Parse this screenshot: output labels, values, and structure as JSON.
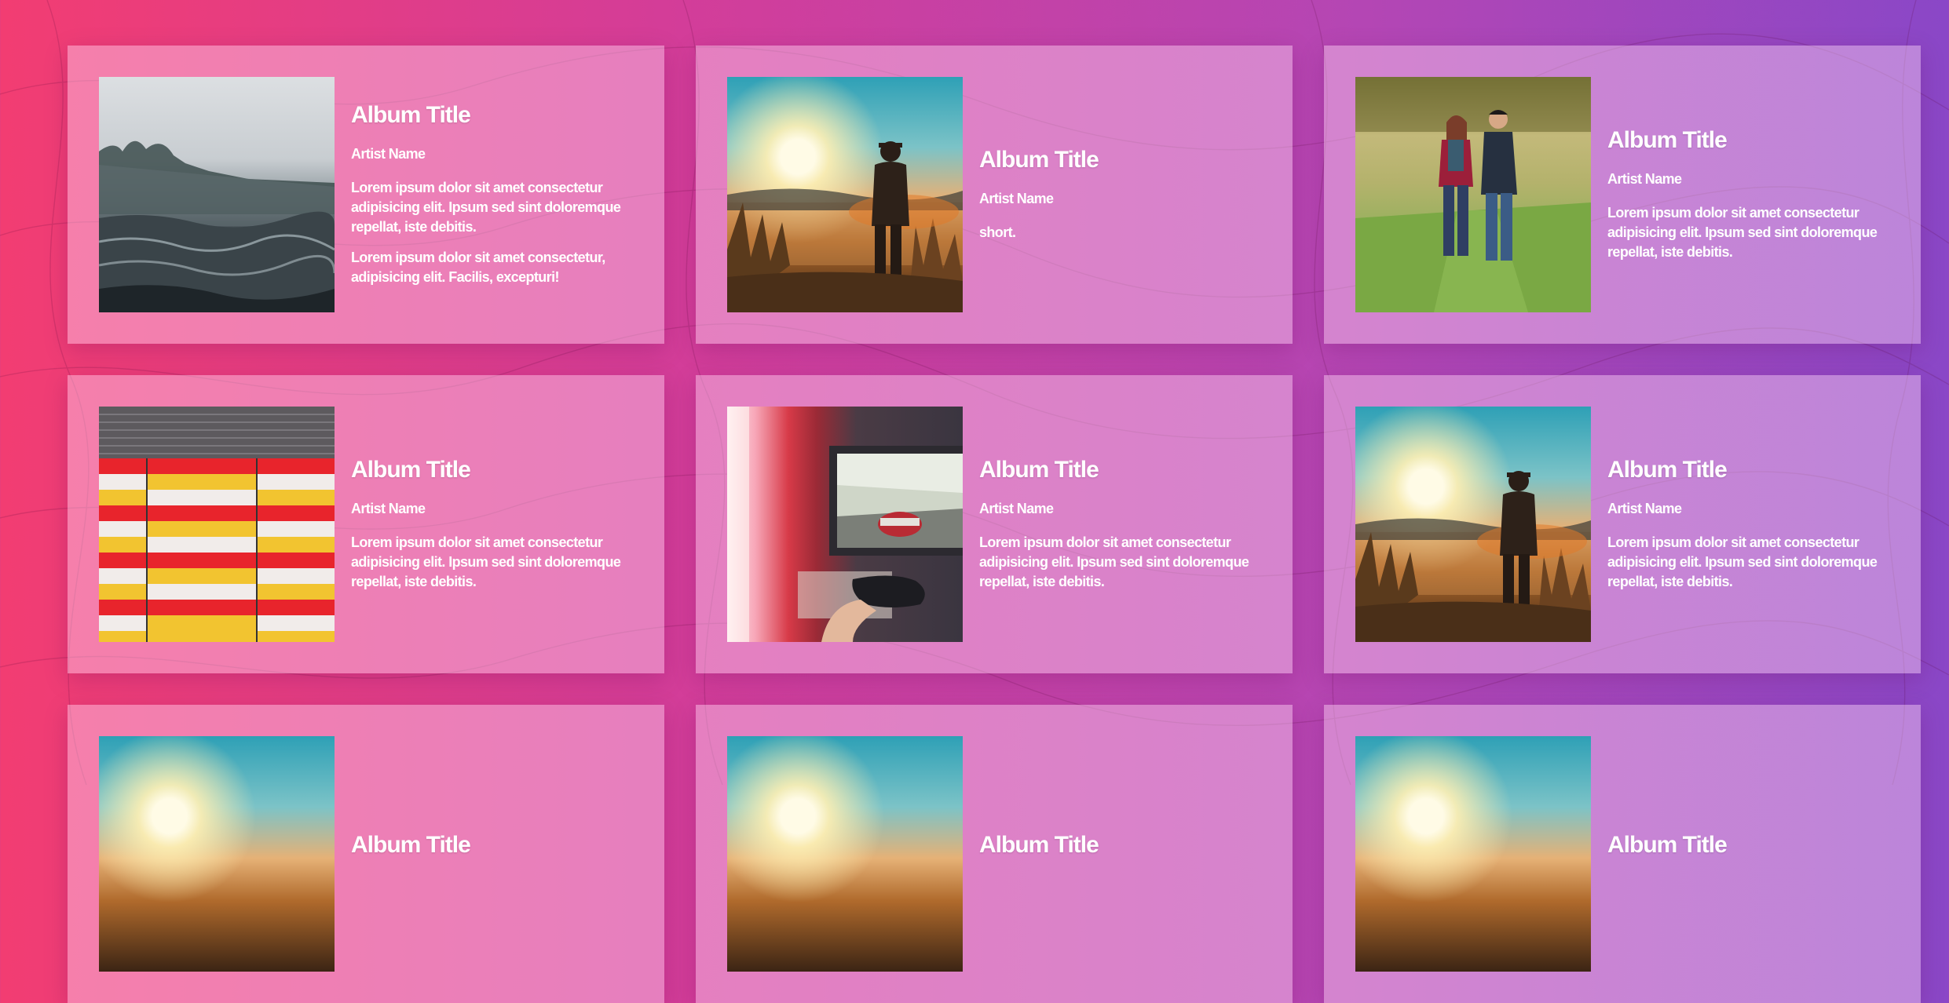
{
  "cards": [
    {
      "cover": "misty-river",
      "title": "Album Title",
      "artist": "Artist Name",
      "paragraphs": [
        "Lorem ipsum dolor sit amet consectetur adipisicing elit. Ipsum sed sint doloremque repellat, iste debitis.",
        "Lorem ipsum dolor sit amet consectetur, adipisicing elit. Facilis, excepturi!"
      ]
    },
    {
      "cover": "silhouette-sunset",
      "title": "Album Title",
      "artist": "Artist Name",
      "paragraphs": [
        "short."
      ]
    },
    {
      "cover": "couple-walking",
      "title": "Album Title",
      "artist": "Artist Name",
      "paragraphs": [
        "Lorem ipsum dolor sit amet consectetur adipisicing elit. Ipsum sed sint doloremque repellat, iste debitis."
      ]
    },
    {
      "cover": "striped-building",
      "title": "Album Title",
      "artist": "Artist Name",
      "paragraphs": [
        "Lorem ipsum dolor sit amet consectetur adipisicing elit. Ipsum sed sint doloremque repellat, iste debitis."
      ]
    },
    {
      "cover": "video-game-screen",
      "title": "Album Title",
      "artist": "Artist Name",
      "paragraphs": [
        "Lorem ipsum dolor sit amet consectetur adipisicing elit. Ipsum sed sint doloremque repellat, iste debitis."
      ]
    },
    {
      "cover": "silhouette-sunset",
      "title": "Album Title",
      "artist": "Artist Name",
      "paragraphs": [
        "Lorem ipsum dolor sit amet consectetur adipisicing elit. Ipsum sed sint doloremque repellat, iste debitis."
      ]
    },
    {
      "cover": "silhouette-sunset",
      "title": "Album Title",
      "artist": "",
      "paragraphs": []
    },
    {
      "cover": "silhouette-sunset",
      "title": "Album Title",
      "artist": "",
      "paragraphs": []
    },
    {
      "cover": "silhouette-sunset",
      "title": "Album Title",
      "artist": "",
      "paragraphs": []
    }
  ],
  "colors": {
    "gradient_start": "#f23d72",
    "gradient_end": "#8a47c7",
    "card_tint": "#ffdcf5",
    "text": "#ffffff"
  }
}
